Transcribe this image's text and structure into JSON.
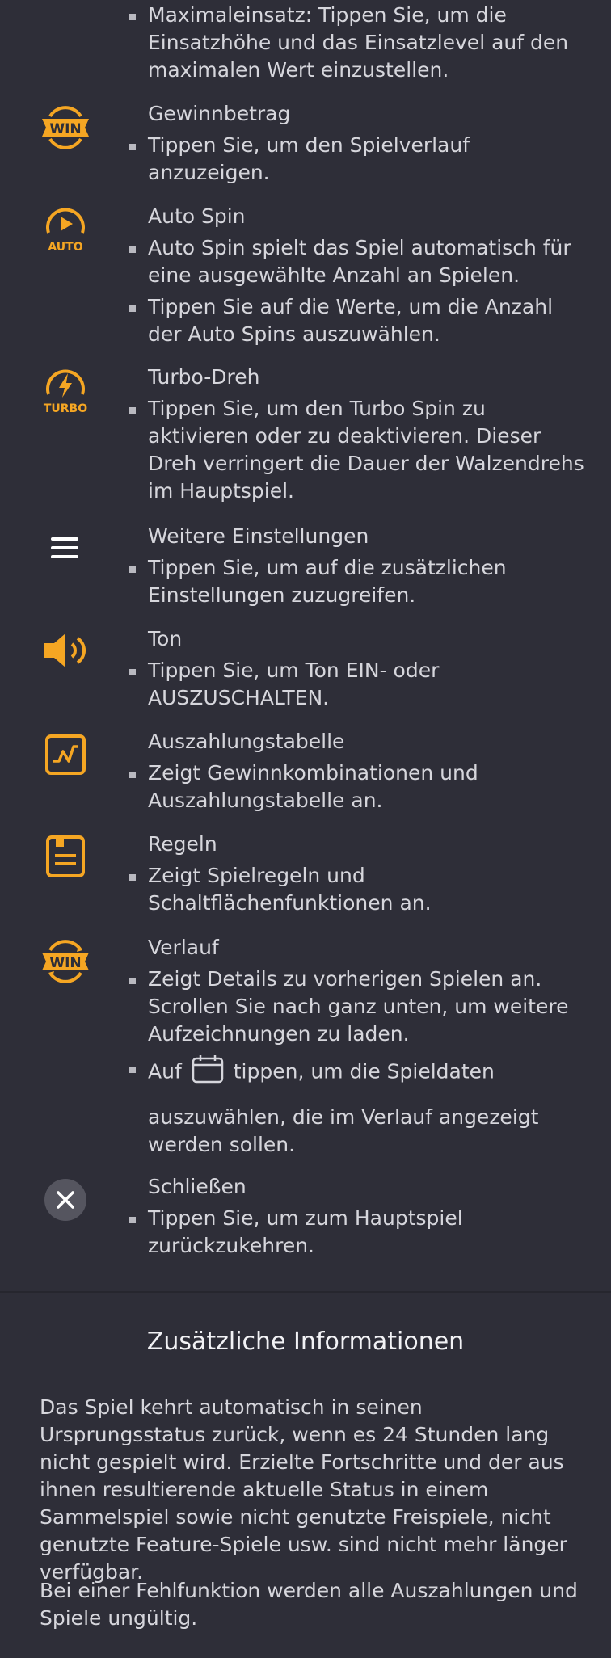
{
  "items": [
    {
      "id": "max-bet",
      "bullets": [
        "Maximaleinsatz: Tippen Sie, um die Einsatzhöhe und das Einsatzlevel auf den maximalen Wert einzustellen."
      ]
    },
    {
      "id": "win",
      "icon": "win-icon",
      "title": "Gewinnbetrag",
      "bullets": [
        "Tippen Sie, um den Spielverlauf anzuzeigen."
      ]
    },
    {
      "id": "auto",
      "icon": "auto-spin-icon",
      "icon_label": "AUTO",
      "title": "Auto Spin",
      "bullets": [
        "Auto Spin spielt das Spiel automatisch für eine ausgewählte Anzahl an Spielen.",
        "Tippen Sie auf die Werte, um die Anzahl der Auto Spins auszuwählen."
      ]
    },
    {
      "id": "turbo",
      "icon": "turbo-icon",
      "icon_label": "TURBO",
      "title": "Turbo-Dreh",
      "bullets": [
        "Tippen Sie, um den Turbo Spin zu aktivieren oder zu deaktivieren. Dieser Dreh verringert die Dauer der Walzendrehs im Hauptspiel."
      ]
    },
    {
      "id": "menu",
      "icon": "menu-icon",
      "title": "Weitere Einstellungen",
      "bullets": [
        "Tippen Sie, um auf die zusätzlichen Einstellungen zuzugreifen."
      ]
    },
    {
      "id": "sound",
      "icon": "speaker-icon",
      "title": "Ton",
      "bullets": [
        "Tippen Sie, um Ton EIN- oder AUSZUSCHALTEN."
      ]
    },
    {
      "id": "paytable",
      "icon": "chart-icon",
      "title": "Auszahlungstabelle",
      "bullets": [
        "Zeigt Gewinnkombinationen und Auszahlungstabelle an."
      ]
    },
    {
      "id": "rules",
      "icon": "rules-icon",
      "title": "Regeln",
      "bullets": [
        "Zeigt Spielregeln und Schaltflächenfunktionen an."
      ]
    },
    {
      "id": "history",
      "icon": "history-win-icon",
      "title": "Verlauf",
      "bullets": [
        "Zeigt Details zu vorherigen Spielen an. Scrollen Sie nach ganz unten, um weitere Aufzeichnungen zu laden."
      ],
      "calendar_bullet": {
        "before": "Auf",
        "after": "tippen, um die Spieldaten",
        "rest": "auszuwählen, die im Verlauf angezeigt werden sollen."
      }
    },
    {
      "id": "close",
      "icon": "close-icon",
      "title": "Schließen",
      "bullets": [
        "Tippen Sie, um zum Hauptspiel zurückzukehren."
      ]
    }
  ],
  "win_icon_text": "WIN",
  "info": {
    "title": "Zusätzliche Informationen",
    "paragraphs": [
      "Das Spiel kehrt automatisch in seinen Ursprungsstatus zurück, wenn es 24 Stunden lang nicht gespielt wird. Erzielte Fortschritte und der aus ihnen resultierende aktuelle Status in einem Sammelspiel sowie nicht genutzte Freispiele, nicht genutzte Feature-Spiele usw. sind nicht mehr länger verfügbar.",
      "Bei einer Fehlfunktion werden alle Auszahlungen und Spiele ungültig."
    ]
  },
  "colors": {
    "accent": "#f5a623",
    "background": "#2e2e38",
    "text": "#d6d6dc"
  }
}
